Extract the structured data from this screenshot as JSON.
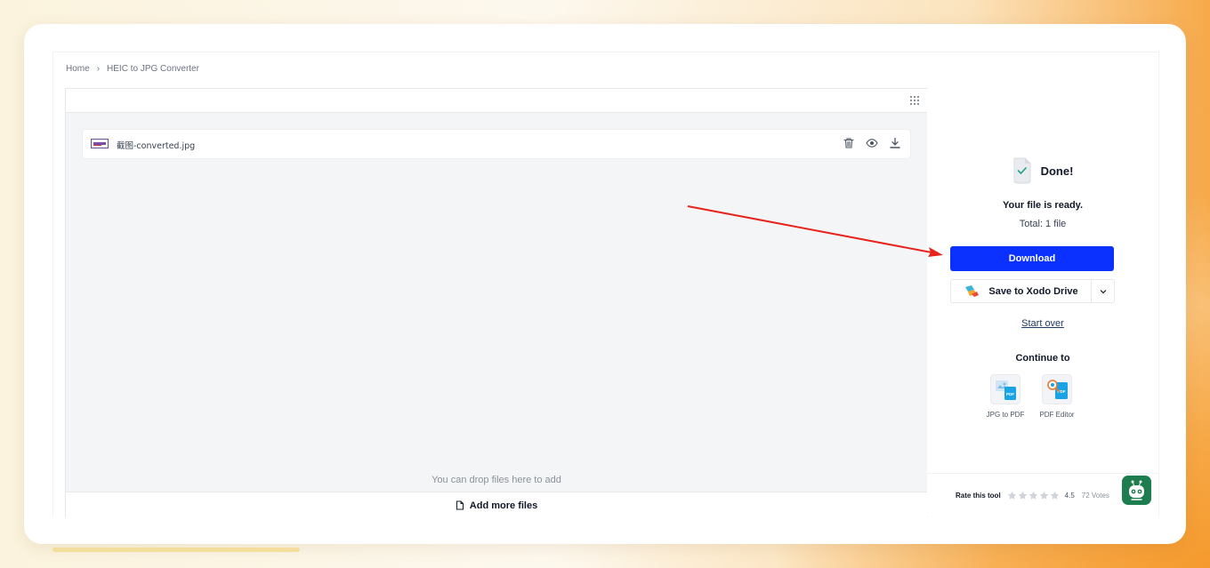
{
  "breadcrumb": {
    "home": "Home",
    "separator": "›",
    "current": "HEIC to JPG Converter"
  },
  "file": {
    "name": "截图-converted.jpg"
  },
  "workspace": {
    "drop_hint": "You can drop files here to add",
    "add_more_label": "Add more files"
  },
  "result": {
    "title": "Done!",
    "ready_text": "Your file is ready.",
    "total_text": "Total: 1 file",
    "download_label": "Download",
    "save_drive_label": "Save to Xodo Drive",
    "start_over_label": "Start over"
  },
  "continue": {
    "heading": "Continue to",
    "tools": [
      {
        "label": "JPG to PDF",
        "icon": "jpg-to-pdf-icon"
      },
      {
        "label": "PDF Editor",
        "icon": "pdf-editor-icon"
      }
    ]
  },
  "rating": {
    "label": "Rate this tool",
    "value": "4.5",
    "votes": "72 Votes",
    "stars_filled": 0,
    "stars_total": 5
  },
  "colors": {
    "primary": "#0a31ff",
    "annotation_arrow": "#e8231b",
    "mascot": "#1e7d4f"
  }
}
